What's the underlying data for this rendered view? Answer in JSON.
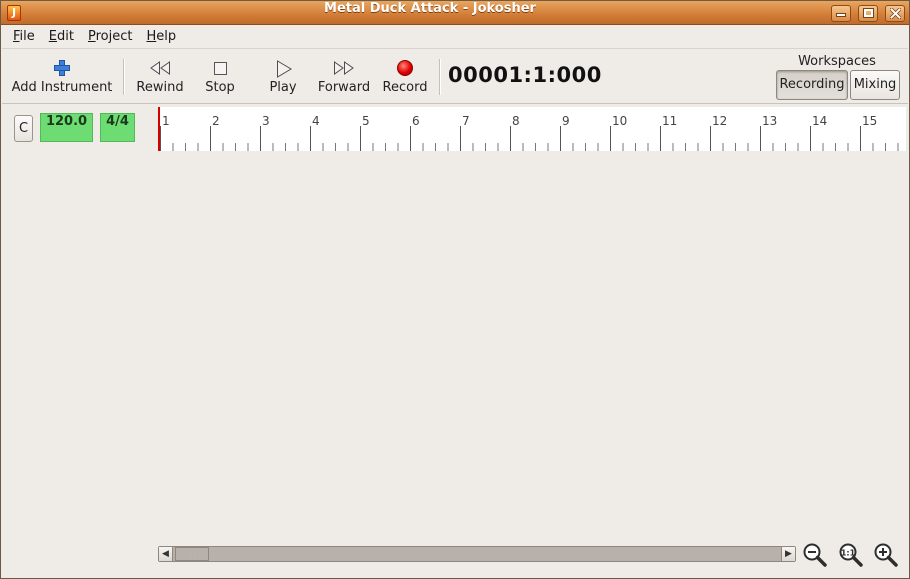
{
  "window": {
    "title": "Metal Duck Attack - Jokosher",
    "app_icon_glyph": "J",
    "controls": [
      "minimize",
      "maximize",
      "close"
    ]
  },
  "menu": {
    "items": [
      {
        "accel": "F",
        "rest": "ile"
      },
      {
        "accel": "E",
        "rest": "dit"
      },
      {
        "accel": "P",
        "rest": "roject"
      },
      {
        "accel": "H",
        "rest": "elp"
      }
    ]
  },
  "toolbar": {
    "add_instrument": "Add Instrument",
    "rewind": "Rewind",
    "stop": "Stop",
    "play": "Play",
    "forward": "Forward",
    "record": "Record",
    "timecode": "00001:1:000"
  },
  "workspaces": {
    "label": "Workspaces",
    "recording": "Recording",
    "mixing": "Mixing",
    "active": "Recording"
  },
  "status": {
    "key": "C",
    "bpm": "120.0",
    "time_signature": "4/4"
  },
  "ruler": {
    "bars": [
      "1",
      "2",
      "3",
      "4",
      "5",
      "6",
      "7",
      "8",
      "9",
      "10",
      "11",
      "12",
      "13",
      "14",
      "15"
    ],
    "beats_per_bar": 4
  },
  "colors": {
    "title_bar": "#d4803a",
    "tempo_box": "#6ddc73",
    "record": "#e00000",
    "playhead": "#d40000"
  },
  "icons": {
    "add": "plus-icon",
    "rewind": "rewind-icon",
    "stop": "stop-icon",
    "play": "play-icon",
    "forward": "fast-forward-icon",
    "record": "record-icon",
    "zoom_out": "zoom-out-icon",
    "zoom_fit": "zoom-fit-icon",
    "zoom_in": "zoom-in-icon"
  }
}
